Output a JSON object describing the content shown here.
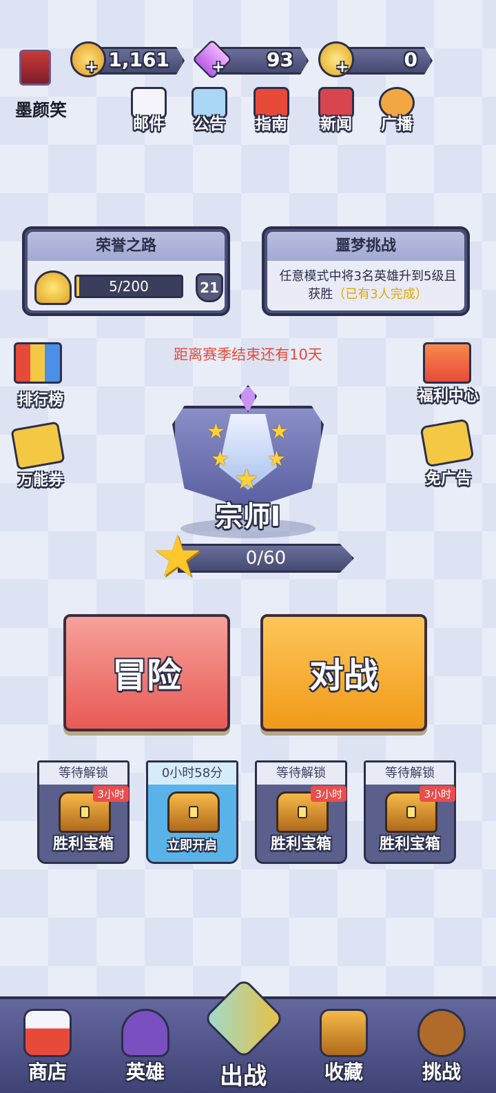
{
  "profile": {
    "name": "墨颜笑"
  },
  "resources": [
    {
      "icon": "crown-coin-icon",
      "value": "1,161",
      "color": "#f4b23a"
    },
    {
      "icon": "purple-gem-icon",
      "value": "93",
      "color": "#d487f0"
    },
    {
      "icon": "gold-star-coin-icon",
      "value": "0",
      "color": "#f0c13a"
    }
  ],
  "top_menu": [
    {
      "icon": "mail-icon",
      "label": "邮件"
    },
    {
      "icon": "scroll-icon",
      "label": "公告"
    },
    {
      "icon": "book-icon",
      "label": "指南"
    },
    {
      "icon": "news-tv-icon",
      "label": "新闻"
    },
    {
      "icon": "megaphone-icon",
      "label": "广播"
    }
  ],
  "honor": {
    "title": "荣誉之路",
    "progress_text": "5/200",
    "progress_value": 5,
    "progress_max": 200,
    "level": "21"
  },
  "nightmare": {
    "title": "噩梦挑战",
    "desc": "任意模式中将3名英雄升到5级且获胜",
    "highlight": "（已有3人完成）"
  },
  "season": {
    "text": "距离赛季结束还有10天"
  },
  "left_side": [
    {
      "icon": "leaderboard-icon",
      "label": "排行榜"
    },
    {
      "icon": "ticket-icon",
      "label": "万能券"
    }
  ],
  "right_side": [
    {
      "icon": "gift-box-icon",
      "label": "福利中心"
    },
    {
      "icon": "no-ads-icon",
      "label": "免广告"
    }
  ],
  "rank": {
    "name": "宗师I",
    "stars_text": "0/60"
  },
  "main_buttons": {
    "adventure": "冒险",
    "battle": "对战"
  },
  "chests": [
    {
      "status": "等待解锁",
      "tag": "3小时",
      "label": "胜利宝箱",
      "active": false
    },
    {
      "status": "0小时58分",
      "tag": "",
      "label": "立即开启",
      "active": true
    },
    {
      "status": "等待解锁",
      "tag": "3小时",
      "label": "胜利宝箱",
      "active": false
    },
    {
      "status": "等待解锁",
      "tag": "3小时",
      "label": "胜利宝箱",
      "active": false
    }
  ],
  "bottom_nav": [
    {
      "icon": "shop-icon",
      "label": "商店"
    },
    {
      "icon": "hero-helmet-icon",
      "label": "英雄"
    },
    {
      "icon": "crossed-swords-icon",
      "label": "出战"
    },
    {
      "icon": "treasure-chest-icon",
      "label": "收藏"
    },
    {
      "icon": "crossbow-icon",
      "label": "挑战"
    }
  ]
}
